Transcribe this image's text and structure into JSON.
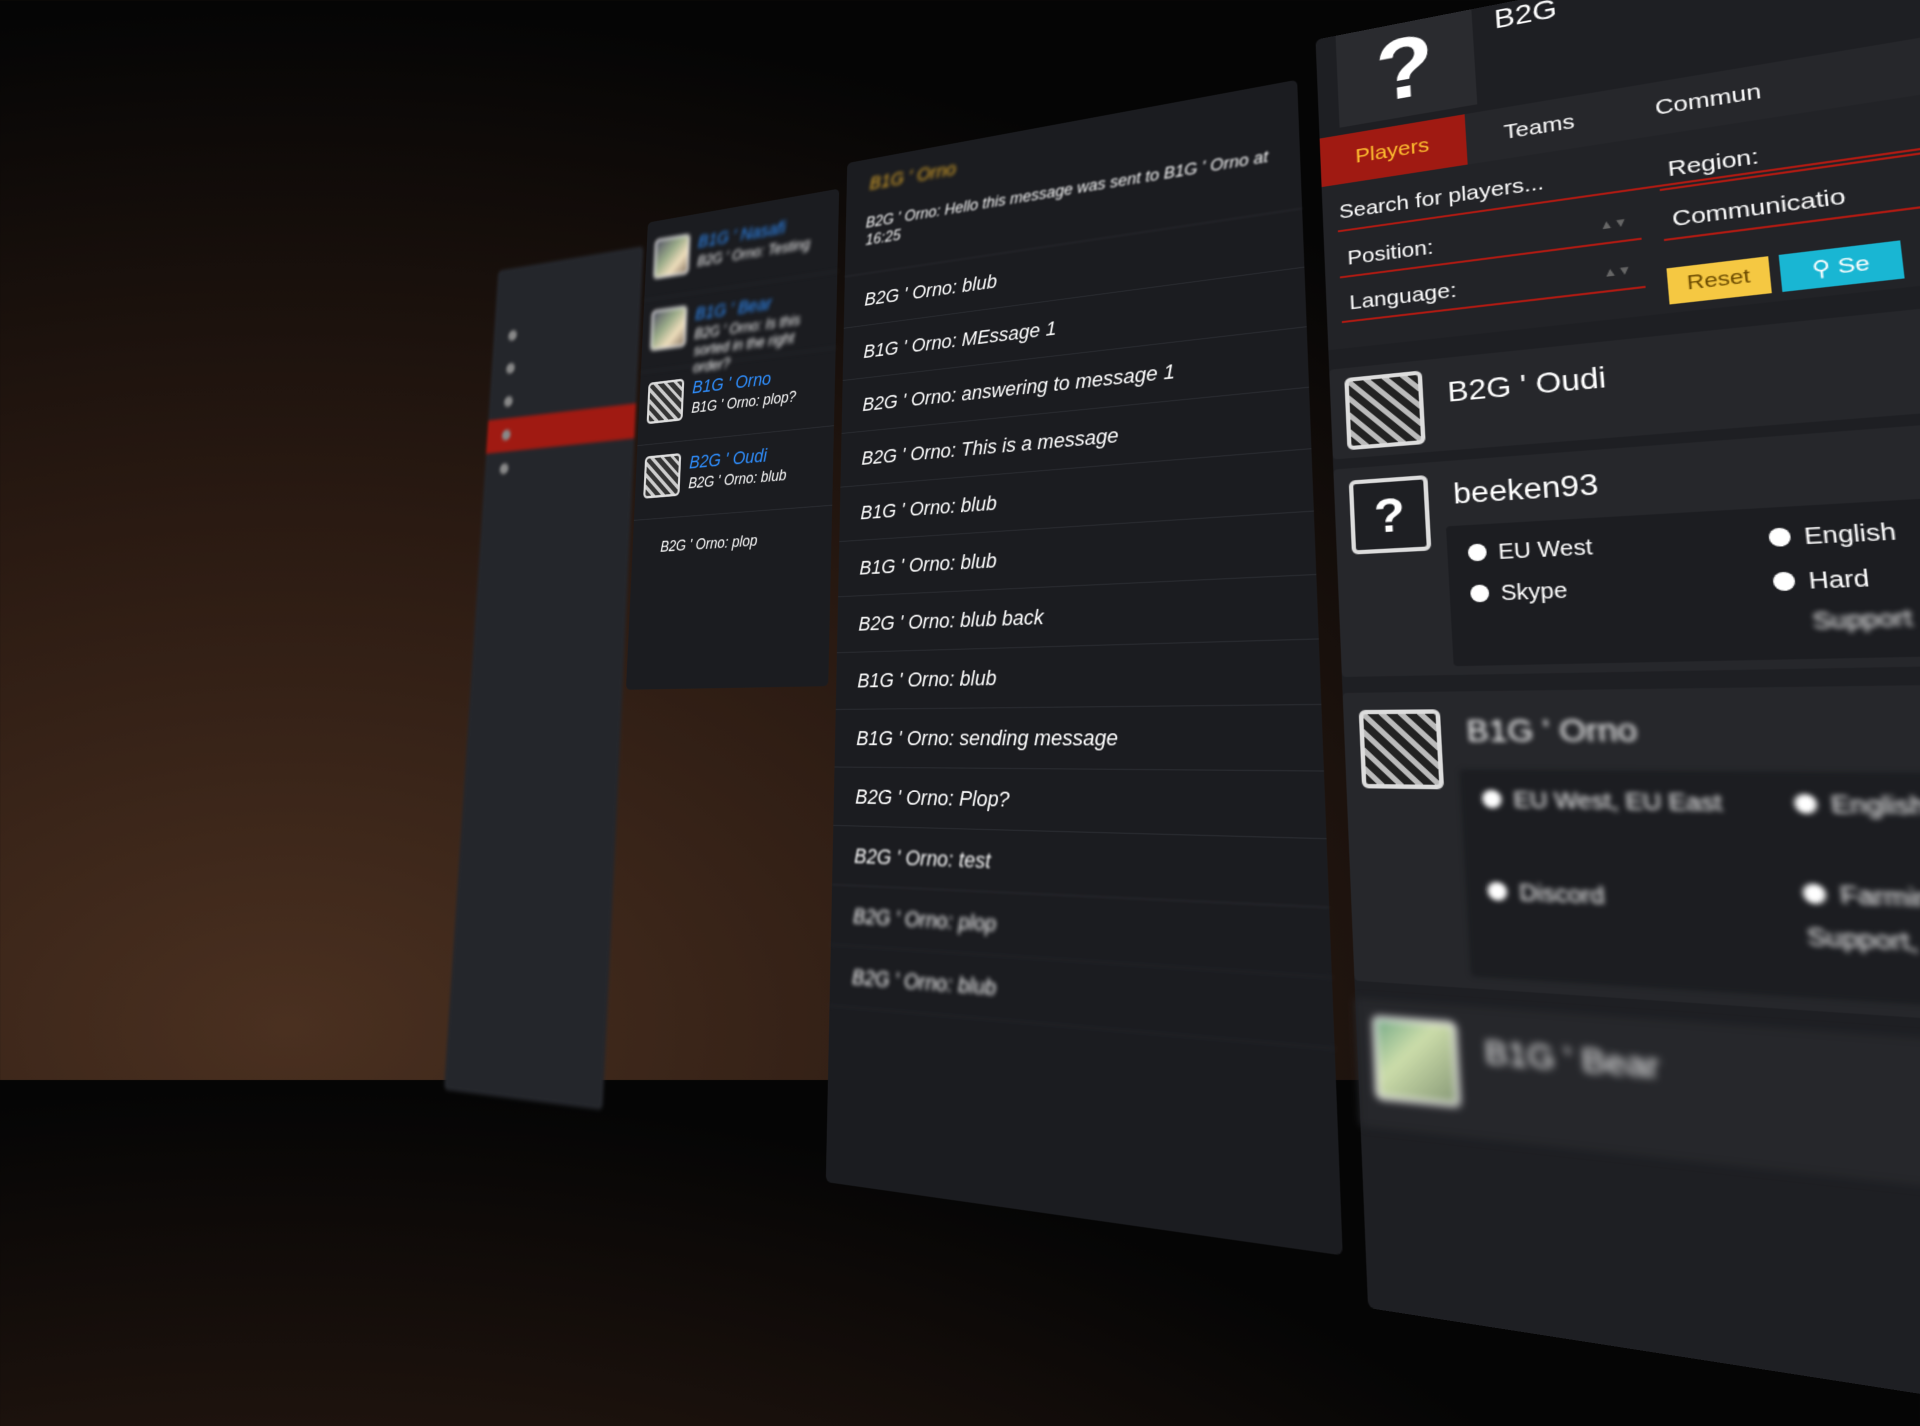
{
  "nav": {
    "title": "",
    "items": [
      {
        "label": "",
        "active": false
      },
      {
        "label": "",
        "active": false
      },
      {
        "label": "",
        "active": false
      },
      {
        "label": "",
        "active": true
      },
      {
        "label": "",
        "active": false
      }
    ]
  },
  "conversations": [
    {
      "name": "B1G ' Nasafi",
      "message": "B2G ' Orno: Testing",
      "blurred": true
    },
    {
      "name": "B1G ' Bear",
      "message": "B2G ' Orno: Is this sorted in the right order?",
      "blurred": true
    },
    {
      "name": "B1G ' Orno",
      "message": "B1G ' Orno: plop?",
      "blurred": false
    },
    {
      "name": "B2G ' Oudi",
      "message": "B2G ' Orno: blub",
      "blurred": false
    }
  ],
  "conversation_extra": "B2G ' Orno: plop",
  "chat": {
    "header": "B1G ' Orno",
    "messages": [
      "B2G ' Orno: Hello this message was sent to B1G ' Orno at 16:25",
      "B2G ' Orno: blub",
      "B1G ' Orno: MEssage 1",
      "B2G ' Orno: answering to message 1",
      "B2G ' Orno: This is a message",
      "B1G ' Orno: blub",
      "B1G ' Orno: blub",
      "B2G ' Orno: blub back",
      "B1G ' Orno: blub",
      "B1G ' Orno: sending message",
      "B2G ' Orno: Plop?",
      "B2G ' Orno: test",
      "B2G ' Orno: plop",
      "B2G ' Orno: blub"
    ]
  },
  "panel": {
    "header_question": "?",
    "header_name": "B2G",
    "tabs": [
      "Players",
      "Teams",
      "Commun"
    ],
    "search_placeholder": "Search for players...",
    "position_label": "Position:",
    "language_label": "Language:",
    "region_label": "Region:",
    "communication_label": "Communicatio",
    "reset_label": "Reset",
    "search_label": "Se"
  },
  "players": [
    {
      "name": "B2G ' Oudi"
    },
    {
      "name": "beeken93",
      "avatar_text": "?",
      "region": "EU West",
      "communication": "Skype",
      "language": "English",
      "difficulty": "Hard",
      "role": "Support"
    },
    {
      "name": "B1G ' Orno",
      "region": "EU West, EU East",
      "communication": "Discord",
      "language": "English, French",
      "difficulty": "Farming",
      "role": "Support, Hard Support"
    },
    {
      "name": "B1G ' Bear"
    }
  ],
  "colors": {
    "accent_red": "#a01a12",
    "link_blue": "#2f8fff",
    "gold": "#ffc030",
    "reset_yellow": "#f5c842",
    "search_cyan": "#19b6d3"
  }
}
